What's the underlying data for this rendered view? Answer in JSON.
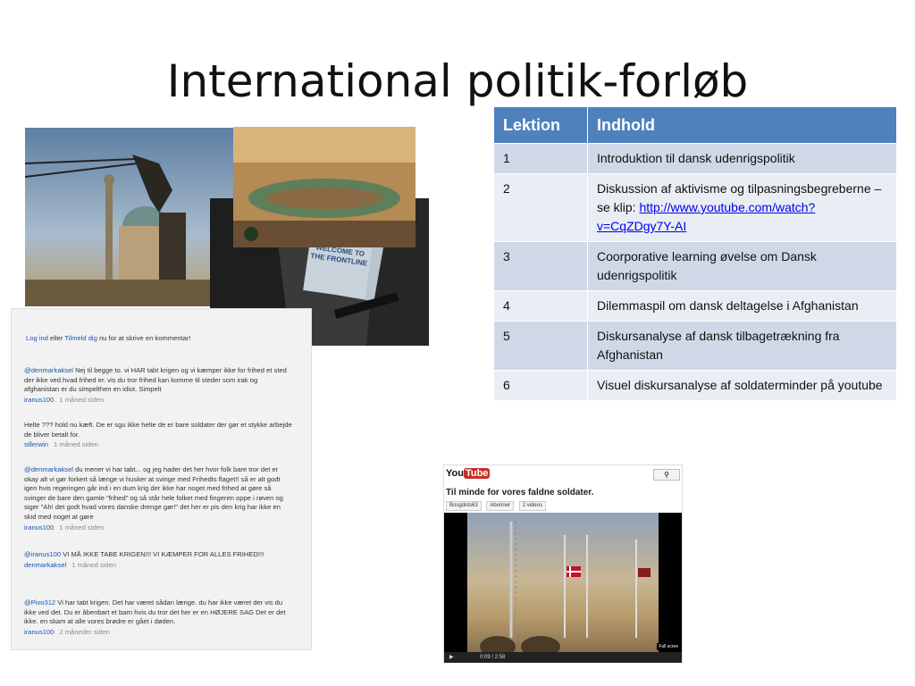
{
  "title": "International politik-forløb",
  "table": {
    "headers": [
      "Lektion",
      "Indhold"
    ],
    "rows": [
      {
        "lektion": "1",
        "indhold": "Introduktion til dansk udenrigspolitik"
      },
      {
        "lektion": "2",
        "indhold": "Diskussion af aktivisme og tilpasningsbegreberne –se klip:",
        "link": "http://www.youtube.com/watch?v=CqZDgy7Y-AI"
      },
      {
        "lektion": "3",
        "indhold": "Coorporative learning øvelse om Dansk udenrigspolitik"
      },
      {
        "lektion": "4",
        "indhold": "Dilemmaspil om dansk deltagelse i Afghanistan"
      },
      {
        "lektion": "5",
        "indhold": "Diskursanalyse af dansk tilbagetrækning fra Afghanistan"
      },
      {
        "lektion": "6",
        "indhold": "Visuel diskursanalyse af soldaterminder på youtube"
      }
    ]
  },
  "collage": {
    "sign_text": "WELCOME TO THE FRONTLINE"
  },
  "comments": {
    "login_link": "Log ind",
    "login_or": "eller",
    "signup_link": "Tilmeld dig",
    "login_suffix": "nu for at skrive en kommentar!",
    "items": [
      {
        "user": "@denmarkaksel",
        "text": "Nej til begge to. vi HAR tabt krigen og vi kæmper ikke for frihed et sted der ikke ved hvad frihed er. vis du tror frihed kan komme til steder som irak og afghanistan er du simpelthen en idiot. Simpelt",
        "author": "iranus100",
        "time": "1 måned siden"
      },
      {
        "user": "",
        "text": "Helte ??? hold nu kæft. De er sgu ikke helte de er bare soldater der gør et stykke arbejde de bliver betalt for.",
        "author": "sillerwin",
        "time": "1 måned siden"
      },
      {
        "user": "@denmarkaksel",
        "text": "du mener vi har tabt... og jeg hader det her hvor folk bare tror det er okay alt vi gør forkert så længe vi husker at svinge med Frihedts flaget!! så er alt godt igen hvis regeringen går ind i en dum krig der ikke har noget med frihed at gøre så svinger de bare den gamle \"frihed\" og så står hele folket med fingeren oppe i røven og siger \"Ah! det godt hvad vores danske drenge gør!\" det her er pis den krig har ikke en skid med noget at gøre",
        "author": "iranus100",
        "time": "1 måned siden"
      },
      {
        "user": "@iranus100",
        "text": "VI MÅ IKKE TABE KRIGEN!!! VI KÆMPER FOR ALLES FRIHED!!!",
        "author": "denmarkaksel",
        "time": "1 måned siden"
      },
      {
        "user": "@Pivo312",
        "text": "Vi har tabt krigen. Det har været sådan længe. du har ikke været der vis du ikke ved det. Du er åbenbart et barn hvis du tror det her er en HØJERE SAG Det er det ikke. en skam at alle vores brødre er gået i døden.",
        "author": "iranus100",
        "time": "2 måneder siden"
      }
    ]
  },
  "youtube": {
    "logo_you": "You",
    "logo_tube": "Tube",
    "video_title": "Til minde for vores faldne soldater.",
    "channel": "Bosgdots63",
    "subscribe": "Abonner",
    "videos": "2 videos",
    "time": "0:09 / 2:58",
    "fullscreen": "Full scree"
  },
  "colors": {
    "table_header": "#4f81bd",
    "row_light": "#e9edf4",
    "row_dark": "#d0d8e8",
    "link": "#1a55b3",
    "youtube_red": "#c4302b"
  }
}
